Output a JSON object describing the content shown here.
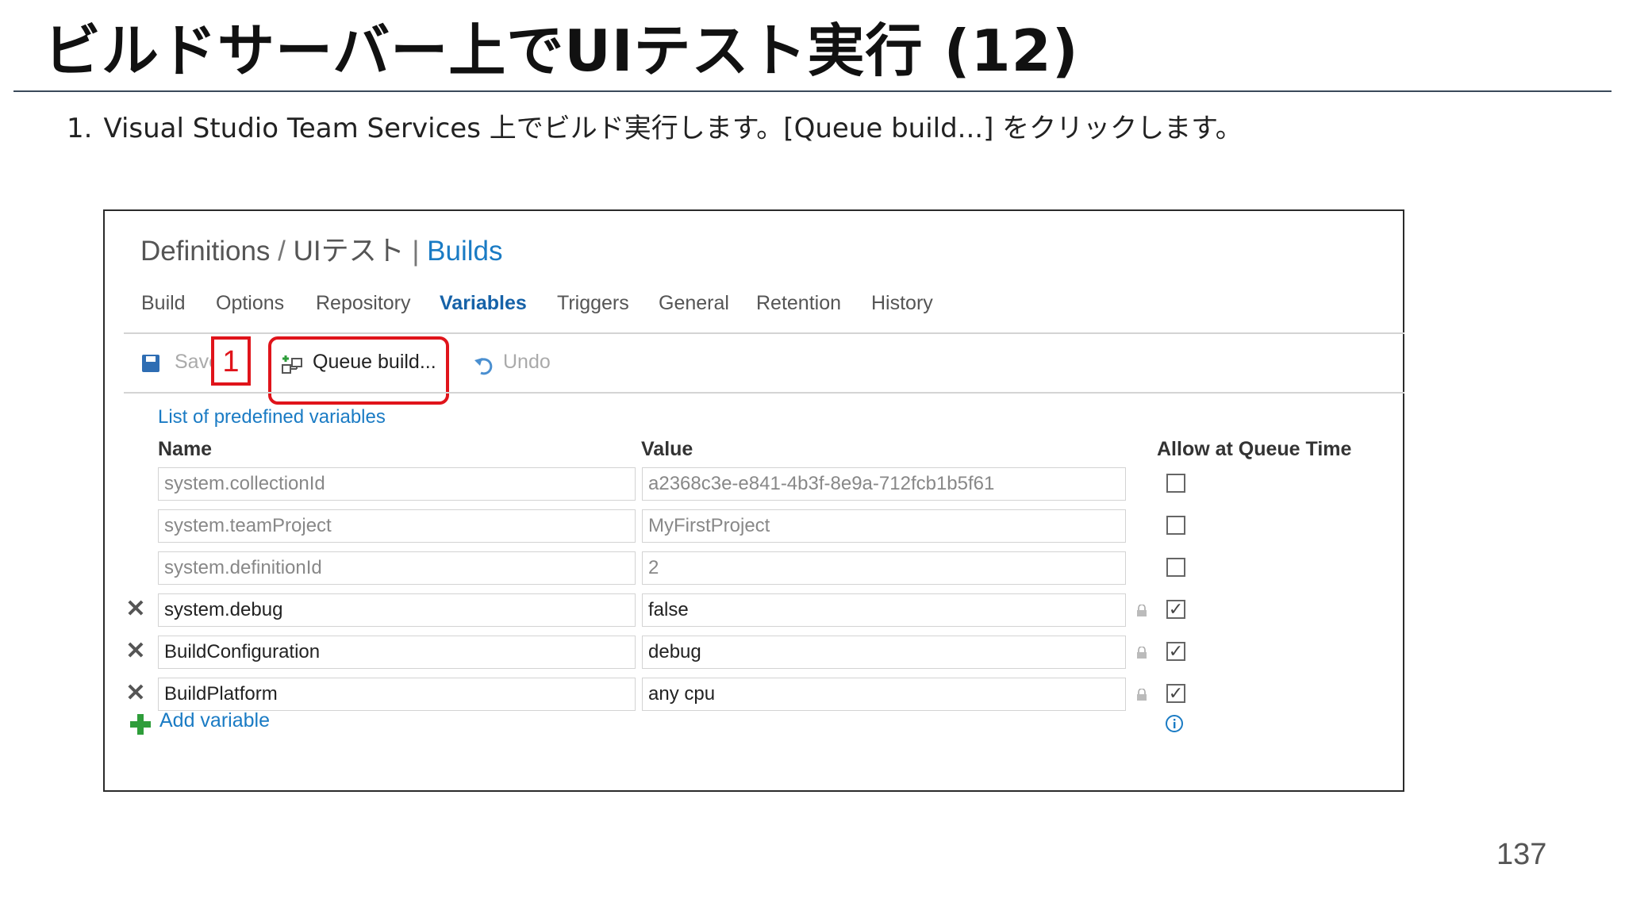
{
  "slide": {
    "title": "ビルドサーバー上でUIテスト実行 (12)",
    "step_number": "1.",
    "step_text": "Visual Studio Team Services 上でビルド実行します。[Queue build...] をクリックします。",
    "page_number": "137"
  },
  "screenshot": {
    "breadcrumb": {
      "part1": "Definitions",
      "sep1": " / ",
      "part2": "UIテスト",
      "sep2": " | ",
      "part3": "Builds"
    },
    "tabs": [
      {
        "label": "Build",
        "active": false
      },
      {
        "label": "Options",
        "active": false
      },
      {
        "label": "Repository",
        "active": false
      },
      {
        "label": "Variables",
        "active": true
      },
      {
        "label": "Triggers",
        "active": false
      },
      {
        "label": "General",
        "active": false
      },
      {
        "label": "Retention",
        "active": false
      },
      {
        "label": "History",
        "active": false
      }
    ],
    "toolbar": {
      "save_label": "Save",
      "queue_label": "Queue build...",
      "undo_label": "Undo"
    },
    "callout_number": "1",
    "predefined_link": "List of predefined variables",
    "columns": {
      "name": "Name",
      "value": "Value",
      "allow": "Allow at Queue Time"
    },
    "rows": [
      {
        "name": "system.collectionId",
        "value": "a2368c3e-e841-4b3f-8e9a-712fcb1b5f61",
        "checked": false,
        "deletable": false
      },
      {
        "name": "system.teamProject",
        "value": "MyFirstProject",
        "checked": false,
        "deletable": false
      },
      {
        "name": "system.definitionId",
        "value": "2",
        "checked": false,
        "deletable": false
      },
      {
        "name": "system.debug",
        "value": "false",
        "checked": true,
        "deletable": true
      },
      {
        "name": "BuildConfiguration",
        "value": "debug",
        "checked": true,
        "deletable": true
      },
      {
        "name": "BuildPlatform",
        "value": "any cpu",
        "checked": true,
        "deletable": true
      }
    ],
    "add_variable_label": "Add variable",
    "colors": {
      "accent": "#1a7bc4",
      "callout": "#e0141b"
    }
  }
}
